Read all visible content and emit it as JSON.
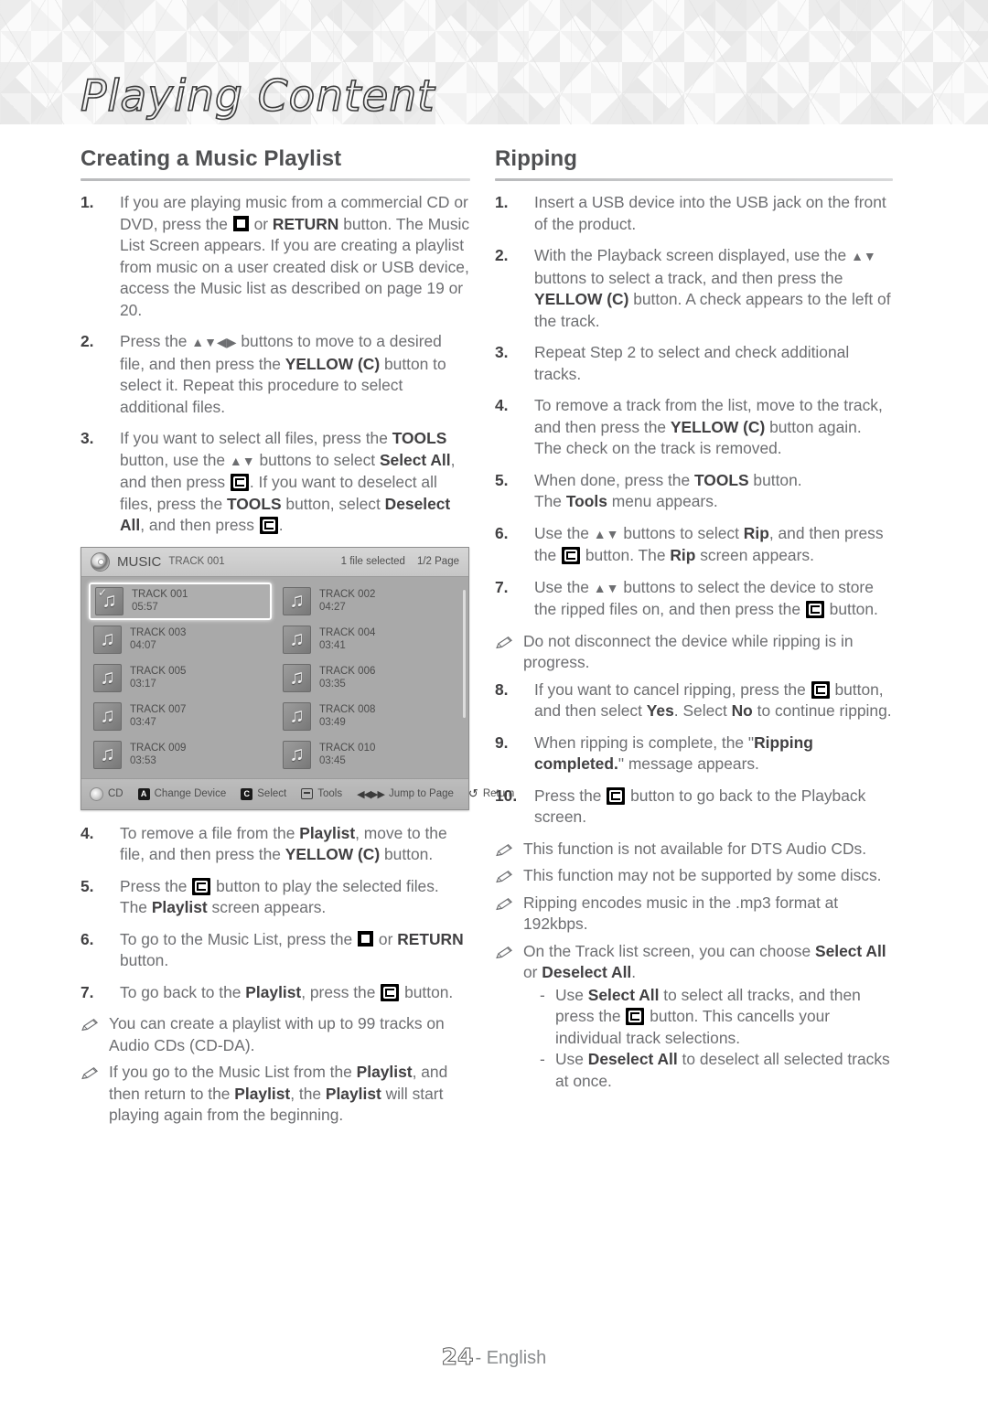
{
  "header": {
    "title": "Playing Content"
  },
  "footer": {
    "page_number": "24",
    "separator": "-",
    "language": "English"
  },
  "left_column": {
    "section_title": "Creating a Music Playlist",
    "steps": [
      {
        "num": "1.",
        "parts": [
          {
            "t": "text",
            "v": "If you are playing music from a commercial CD or DVD, press the "
          },
          {
            "t": "icon",
            "v": "stop-button-icon"
          },
          {
            "t": "text",
            "v": " or "
          },
          {
            "t": "bold",
            "v": "RETURN"
          },
          {
            "t": "text",
            "v": " button. The Music List Screen appears. If you are creating a playlist from music on a user created disk or USB device, access the Music list as described on page 19 or 20."
          }
        ]
      },
      {
        "num": "2.",
        "parts": [
          {
            "t": "text",
            "v": "Press the "
          },
          {
            "t": "arrows",
            "v": "▲▼◀▶"
          },
          {
            "t": "text",
            "v": " buttons to move to a desired file, and then press the "
          },
          {
            "t": "bold",
            "v": "YELLOW (C)"
          },
          {
            "t": "text",
            "v": " button to select it. Repeat this procedure to select additional files."
          }
        ]
      },
      {
        "num": "3.",
        "parts": [
          {
            "t": "text",
            "v": "If you want to select all files, press the "
          },
          {
            "t": "bold",
            "v": "TOOLS"
          },
          {
            "t": "text",
            "v": " button, use the "
          },
          {
            "t": "arrows",
            "v": "▲▼"
          },
          {
            "t": "text",
            "v": " buttons to select "
          },
          {
            "t": "bold",
            "v": "Select All"
          },
          {
            "t": "text",
            "v": ", and then press "
          },
          {
            "t": "icon",
            "v": "enter-button-icon"
          },
          {
            "t": "text",
            "v": ". If you want to deselect all files, press the "
          },
          {
            "t": "bold",
            "v": "TOOLS"
          },
          {
            "t": "text",
            "v": " button, select "
          },
          {
            "t": "bold",
            "v": "Deselect All"
          },
          {
            "t": "text",
            "v": ", and then press "
          },
          {
            "t": "icon",
            "v": "enter-button-icon"
          },
          {
            "t": "text",
            "v": "."
          }
        ]
      }
    ],
    "steps_after": [
      {
        "num": "4.",
        "parts": [
          {
            "t": "text",
            "v": "To remove a file from the "
          },
          {
            "t": "bold",
            "v": "Playlist"
          },
          {
            "t": "text",
            "v": ", move to the file, and then press the "
          },
          {
            "t": "bold",
            "v": "YELLOW (C)"
          },
          {
            "t": "text",
            "v": " button."
          }
        ]
      },
      {
        "num": "5.",
        "parts": [
          {
            "t": "text",
            "v": "Press the "
          },
          {
            "t": "icon",
            "v": "enter-button-icon"
          },
          {
            "t": "text",
            "v": " button to play the selected files. The "
          },
          {
            "t": "bold",
            "v": "Playlist"
          },
          {
            "t": "text",
            "v": " screen appears."
          }
        ]
      },
      {
        "num": "6.",
        "parts": [
          {
            "t": "text",
            "v": "To go to the Music List, press the "
          },
          {
            "t": "icon",
            "v": "stop-button-icon"
          },
          {
            "t": "text",
            "v": " or "
          },
          {
            "t": "bold",
            "v": "RETURN"
          },
          {
            "t": "text",
            "v": " button."
          }
        ]
      },
      {
        "num": "7.",
        "parts": [
          {
            "t": "text",
            "v": "To go back to the "
          },
          {
            "t": "bold",
            "v": "Playlist"
          },
          {
            "t": "text",
            "v": ", press the "
          },
          {
            "t": "icon",
            "v": "enter-button-icon"
          },
          {
            "t": "text",
            "v": " button."
          }
        ]
      }
    ],
    "notes": [
      {
        "parts": [
          {
            "t": "text",
            "v": "You can create a playlist with up to 99 tracks on Audio CDs (CD-DA)."
          }
        ]
      },
      {
        "parts": [
          {
            "t": "text",
            "v": "If you go to the Music List from the "
          },
          {
            "t": "bold",
            "v": "Playlist"
          },
          {
            "t": "text",
            "v": ", and then return to the "
          },
          {
            "t": "bold",
            "v": "Playlist"
          },
          {
            "t": "text",
            "v": ", the "
          },
          {
            "t": "bold",
            "v": "Playlist"
          },
          {
            "t": "text",
            "v": " will start playing again from the beginning."
          }
        ]
      }
    ]
  },
  "screenshot": {
    "disc_icon": "disc-icon",
    "title": "MUSIC",
    "subtitle": "TRACK 001",
    "status_selected": "1 file selected",
    "status_page": "1/2 Page",
    "tracks": [
      {
        "name": "TRACK 001",
        "time": "05:57",
        "selected": true,
        "checked": true
      },
      {
        "name": "TRACK 002",
        "time": "04:27",
        "selected": false,
        "checked": false
      },
      {
        "name": "TRACK 003",
        "time": "04:07",
        "selected": false,
        "checked": false
      },
      {
        "name": "TRACK 004",
        "time": "03:41",
        "selected": false,
        "checked": false
      },
      {
        "name": "TRACK 005",
        "time": "03:17",
        "selected": false,
        "checked": false
      },
      {
        "name": "TRACK 006",
        "time": "03:35",
        "selected": false,
        "checked": false
      },
      {
        "name": "TRACK 007",
        "time": "03:47",
        "selected": false,
        "checked": false
      },
      {
        "name": "TRACK 008",
        "time": "03:49",
        "selected": false,
        "checked": false
      },
      {
        "name": "TRACK 009",
        "time": "03:53",
        "selected": false,
        "checked": false
      },
      {
        "name": "TRACK 010",
        "time": "03:45",
        "selected": false,
        "checked": false
      }
    ],
    "bottom_bar": [
      {
        "icon": "disc-icon",
        "label": "CD"
      },
      {
        "icon": "key-a-icon",
        "label": "Change Device",
        "key": "A"
      },
      {
        "icon": "key-c-icon",
        "label": "Select",
        "key": "C"
      },
      {
        "icon": "tools-icon",
        "label": "Tools"
      },
      {
        "icon": "jump-to-page-icon",
        "label": "Jump to Page",
        "glyph": "◀◀▶▶"
      },
      {
        "icon": "return-icon",
        "label": "Return",
        "glyph": "↺"
      }
    ]
  },
  "right_column": {
    "section_title": "Ripping",
    "steps": [
      {
        "num": "1.",
        "parts": [
          {
            "t": "text",
            "v": "Insert a USB device into the USB jack on the front of the product."
          }
        ]
      },
      {
        "num": "2.",
        "parts": [
          {
            "t": "text",
            "v": "With the Playback screen displayed, use the "
          },
          {
            "t": "arrows",
            "v": "▲▼"
          },
          {
            "t": "text",
            "v": " buttons to select a track, and then press the "
          },
          {
            "t": "bold",
            "v": "YELLOW (C)"
          },
          {
            "t": "text",
            "v": " button. A check appears to the left of the track."
          }
        ]
      },
      {
        "num": "3.",
        "parts": [
          {
            "t": "text",
            "v": "Repeat Step 2 to select and check additional tracks."
          }
        ]
      },
      {
        "num": "4.",
        "parts": [
          {
            "t": "text",
            "v": "To remove a track from the list, move to the track, and then press the "
          },
          {
            "t": "bold",
            "v": "YELLOW (C)"
          },
          {
            "t": "text",
            "v": " button again. The check on the track is removed."
          }
        ]
      },
      {
        "num": "5.",
        "parts": [
          {
            "t": "text",
            "v": "When done, press the "
          },
          {
            "t": "bold",
            "v": "TOOLS"
          },
          {
            "t": "text",
            "v": " button."
          },
          {
            "t": "br",
            "v": ""
          },
          {
            "t": "text",
            "v": "The "
          },
          {
            "t": "bold",
            "v": "Tools"
          },
          {
            "t": "text",
            "v": " menu appears."
          }
        ]
      },
      {
        "num": "6.",
        "parts": [
          {
            "t": "text",
            "v": "Use the "
          },
          {
            "t": "arrows",
            "v": "▲▼"
          },
          {
            "t": "text",
            "v": " buttons to select "
          },
          {
            "t": "bold",
            "v": "Rip"
          },
          {
            "t": "text",
            "v": ", and then press the "
          },
          {
            "t": "icon",
            "v": "enter-button-icon"
          },
          {
            "t": "text",
            "v": " button. The "
          },
          {
            "t": "bold",
            "v": "Rip"
          },
          {
            "t": "text",
            "v": " screen appears."
          }
        ]
      },
      {
        "num": "7.",
        "parts": [
          {
            "t": "text",
            "v": "Use the "
          },
          {
            "t": "arrows",
            "v": "▲▼"
          },
          {
            "t": "text",
            "v": " buttons to select the device to store the ripped files on, and then press the "
          },
          {
            "t": "icon",
            "v": "enter-button-icon"
          },
          {
            "t": "text",
            "v": " button."
          }
        ]
      }
    ],
    "note_mid": {
      "parts": [
        {
          "t": "text",
          "v": "Do not disconnect the device while ripping is in progress."
        }
      ]
    },
    "steps2": [
      {
        "num": "8.",
        "parts": [
          {
            "t": "text",
            "v": "If you want to cancel ripping, press the "
          },
          {
            "t": "icon",
            "v": "enter-button-icon"
          },
          {
            "t": "text",
            "v": " button, and then select "
          },
          {
            "t": "bold",
            "v": "Yes"
          },
          {
            "t": "text",
            "v": ". Select "
          },
          {
            "t": "bold",
            "v": "No"
          },
          {
            "t": "text",
            "v": " to continue ripping."
          }
        ]
      },
      {
        "num": "9.",
        "parts": [
          {
            "t": "text",
            "v": "When ripping is complete, the \""
          },
          {
            "t": "bold",
            "v": "Ripping completed."
          },
          {
            "t": "text",
            "v": "\" message appears."
          }
        ]
      },
      {
        "num": "10.",
        "parts": [
          {
            "t": "text",
            "v": "Press the "
          },
          {
            "t": "icon",
            "v": "enter-button-icon"
          },
          {
            "t": "text",
            "v": " button to go back to the Playback screen."
          }
        ]
      }
    ],
    "notes": [
      {
        "parts": [
          {
            "t": "text",
            "v": "This function is not available for DTS Audio CDs."
          }
        ]
      },
      {
        "parts": [
          {
            "t": "text",
            "v": "This function may not be supported by some discs."
          }
        ]
      },
      {
        "parts": [
          {
            "t": "text",
            "v": "Ripping encodes music in the .mp3 format at 192kbps."
          }
        ]
      },
      {
        "parts": [
          {
            "t": "text",
            "v": "On the Track list screen, you can choose "
          },
          {
            "t": "bold",
            "v": "Select All"
          },
          {
            "t": "text",
            "v": " or "
          },
          {
            "t": "bold",
            "v": "Deselect All"
          },
          {
            "t": "text",
            "v": "."
          }
        ],
        "sub": [
          {
            "dash": "-",
            "parts": [
              {
                "t": "text",
                "v": "Use "
              },
              {
                "t": "bold",
                "v": "Select All"
              },
              {
                "t": "text",
                "v": " to select all tracks, and then press the "
              },
              {
                "t": "icon",
                "v": "enter-button-icon"
              },
              {
                "t": "text",
                "v": " button. This cancells your individual track selections."
              }
            ]
          },
          {
            "dash": "-",
            "parts": [
              {
                "t": "text",
                "v": "Use "
              },
              {
                "t": "bold",
                "v": "Deselect All"
              },
              {
                "t": "text",
                "v": " to deselect all selected tracks at once."
              }
            ]
          }
        ]
      }
    ]
  }
}
